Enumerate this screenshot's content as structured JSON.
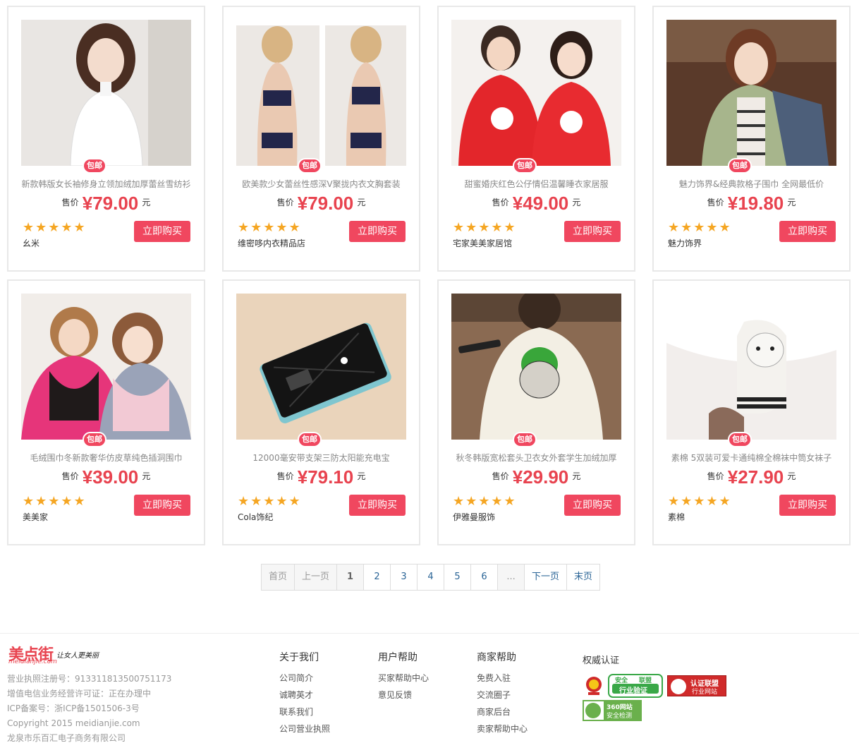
{
  "products": [
    {
      "badge": "包邮",
      "title": "新款韩版女长袖修身立领加绒加厚蕾丝雪纺衫",
      "price_label": "售价",
      "price": "¥79.00",
      "unit": "元",
      "stars": "★★★★★",
      "shop": "幺米",
      "buy": "立即购买",
      "image": "woman-white-blouse"
    },
    {
      "badge": "包邮",
      "title": "欧美款少女蕾丝性感深V聚拢内衣文胸套装",
      "price_label": "售价",
      "price": "¥79.00",
      "unit": "元",
      "stars": "★★★★★",
      "shop": "维密哆内衣精品店",
      "buy": "立即购买",
      "image": "lingerie-models"
    },
    {
      "badge": "包邮",
      "title": "甜蜜婚庆红色公仔情侣温馨睡衣家居服",
      "price_label": "售价",
      "price": "¥49.00",
      "unit": "元",
      "stars": "★★★★★",
      "shop": "宅家美美家居馆",
      "buy": "立即购买",
      "image": "couple-red-pajamas"
    },
    {
      "badge": "包邮",
      "title": "魅力饰界&经典款格子围巾 全网最低价",
      "price_label": "售价",
      "price": "¥19.80",
      "unit": "元",
      "stars": "★★★★★",
      "shop": "魅力饰界",
      "buy": "立即购买",
      "image": "woman-plaid-scarf"
    },
    {
      "badge": "包邮",
      "title": "毛绒围巾冬新款奢华仿皮草纯色插洞围巾",
      "price_label": "售价",
      "price": "¥39.00",
      "unit": "元",
      "stars": "★★★★★",
      "shop": "美美家",
      "buy": "立即购买",
      "image": "girls-fur-scarves"
    },
    {
      "badge": "包邮",
      "title": "12000毫安带支架三防太阳能充电宝",
      "price_label": "售价",
      "price": "¥79.10",
      "unit": "元",
      "stars": "★★★★★",
      "shop": "Cola饰纪",
      "buy": "立即购买",
      "image": "solar-power-bank"
    },
    {
      "badge": "包邮",
      "title": "秋冬韩版宽松套头卫衣女外套学生加绒加厚",
      "price_label": "售价",
      "price": "¥29.90",
      "unit": "元",
      "stars": "★★★★★",
      "shop": "伊雅曼服饰",
      "buy": "立即购买",
      "image": "bulldog-sweatshirt"
    },
    {
      "badge": "包邮",
      "title": "素棉 5双装可爱卡通纯棉全棉袜中筒女袜子",
      "price_label": "售价",
      "price": "¥27.90",
      "unit": "元",
      "stars": "★★★★★",
      "shop": "素棉",
      "buy": "立即购买",
      "image": "cartoon-socks"
    }
  ],
  "pagination": {
    "first": "首页",
    "prev": "上一页",
    "pages": [
      "1",
      "2",
      "3",
      "4",
      "5",
      "6"
    ],
    "ellipsis": "...",
    "next": "下一页",
    "last": "末页",
    "current": "1"
  },
  "footer": {
    "logo_text": "美点街",
    "logo_domain": "meidianjie.com",
    "logo_slogan": "让女人更美丽",
    "info": [
      "营业执照注册号：913311813500751173",
      "增值电信业务经营许可证：正在办理中",
      "ICP备案号：浙ICP备1501506-3号",
      "Copyright 2015 meidianjie.com",
      "龙泉市乐百汇电子商务有限公司"
    ],
    "columns": [
      {
        "title": "关于我们",
        "links": [
          "公司简介",
          "诚聘英才",
          "联系我们",
          "公司营业执照"
        ]
      },
      {
        "title": "用户帮助",
        "links": [
          "买家帮助中心",
          "意见反馈"
        ]
      },
      {
        "title": "商家帮助",
        "links": [
          "免费入驻",
          "交流圈子",
          "商家后台",
          "卖家帮助中心"
        ]
      }
    ],
    "cert_title": "权威认证",
    "certs": [
      {
        "line1": "安全",
        "line2": "联盟",
        "line3": "行业验证"
      },
      {
        "line1": "认证联盟",
        "line2": "行业网站"
      },
      {
        "line1": "360网站",
        "line2": "安全检测"
      }
    ]
  },
  "colors": {
    "accent": "#f0475f",
    "price": "#e8434f",
    "star": "#f5a623",
    "link": "#2a6496"
  }
}
